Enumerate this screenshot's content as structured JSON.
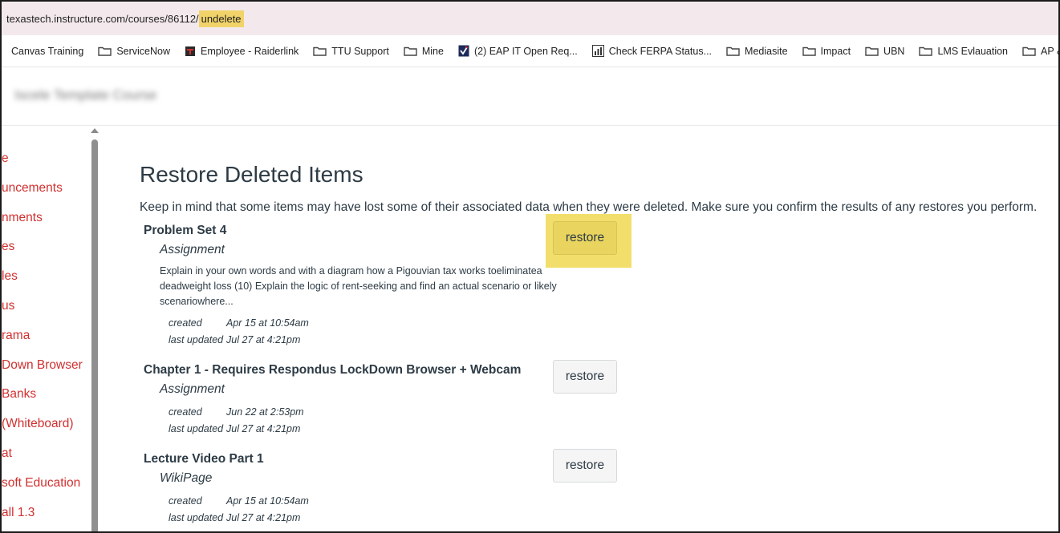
{
  "browser": {
    "url_host": "texastech.instructure.com/courses/86112/",
    "url_highlight": "undelete"
  },
  "bookmarks": [
    {
      "label": "Canvas Training",
      "icon": "none"
    },
    {
      "label": "ServiceNow",
      "icon": "folder-icon"
    },
    {
      "label": "Employee - Raiderlink",
      "icon": "ttu-logo-icon"
    },
    {
      "label": "TTU Support",
      "icon": "folder-icon"
    },
    {
      "label": "Mine",
      "icon": "folder-icon"
    },
    {
      "label": "(2) EAP IT Open Req...",
      "icon": "checkmark-logo-icon"
    },
    {
      "label": "Check FERPA Status...",
      "icon": "bar-chart-icon"
    },
    {
      "label": "Mediasite",
      "icon": "folder-icon"
    },
    {
      "label": "Impact",
      "icon": "folder-icon"
    },
    {
      "label": "UBN",
      "icon": "folder-icon"
    },
    {
      "label": "LMS Evlauation",
      "icon": "folder-icon"
    },
    {
      "label": "AP & FS",
      "icon": "folder-icon"
    }
  ],
  "course": {
    "title": "Iscele Template Course"
  },
  "sidebar": {
    "items": [
      {
        "label": "e"
      },
      {
        "label": "uncements"
      },
      {
        "label": "nments"
      },
      {
        "label": "es"
      },
      {
        "label": "les"
      },
      {
        "label": "us"
      },
      {
        "label": "rama"
      },
      {
        "label": "Down Browser"
      },
      {
        "label": "Banks"
      },
      {
        "label": "(Whiteboard)"
      },
      {
        "label": "at"
      },
      {
        "label": "soft Education"
      },
      {
        "label": "all 1.3"
      }
    ]
  },
  "main": {
    "title": "Restore Deleted Items",
    "intro": "Keep in mind that some items may have lost some of their associated data when they were deleted. Make sure you confirm the results of any restores you perform.",
    "created_label": "created",
    "updated_label": "last updated",
    "restore_label": "restore",
    "items": [
      {
        "title": "Problem Set 4",
        "type": "Assignment",
        "description": "Explain in your own words and with a diagram how a Pigouvian tax works toeliminatea deadweight loss (10) Explain the logic of rent-seeking and find an actual scenario or likely scenariowhere...",
        "created": "Apr 15 at 10:54am",
        "updated": "Jul 27 at 4:21pm"
      },
      {
        "title": "Chapter 1 - Requires Respondus LockDown Browser + Webcam",
        "type": "Assignment",
        "description": "",
        "created": "Jun 22 at 2:53pm",
        "updated": "Jul 27 at 4:21pm"
      },
      {
        "title": "Lecture Video Part 1",
        "type": "WikiPage",
        "description": "",
        "created": "Apr 15 at 10:54am",
        "updated": "Jul 27 at 4:21pm"
      }
    ]
  },
  "colors": {
    "link_red": "#d0302f",
    "highlight_yellow": "#f2df6b",
    "text": "#2d3b45"
  }
}
